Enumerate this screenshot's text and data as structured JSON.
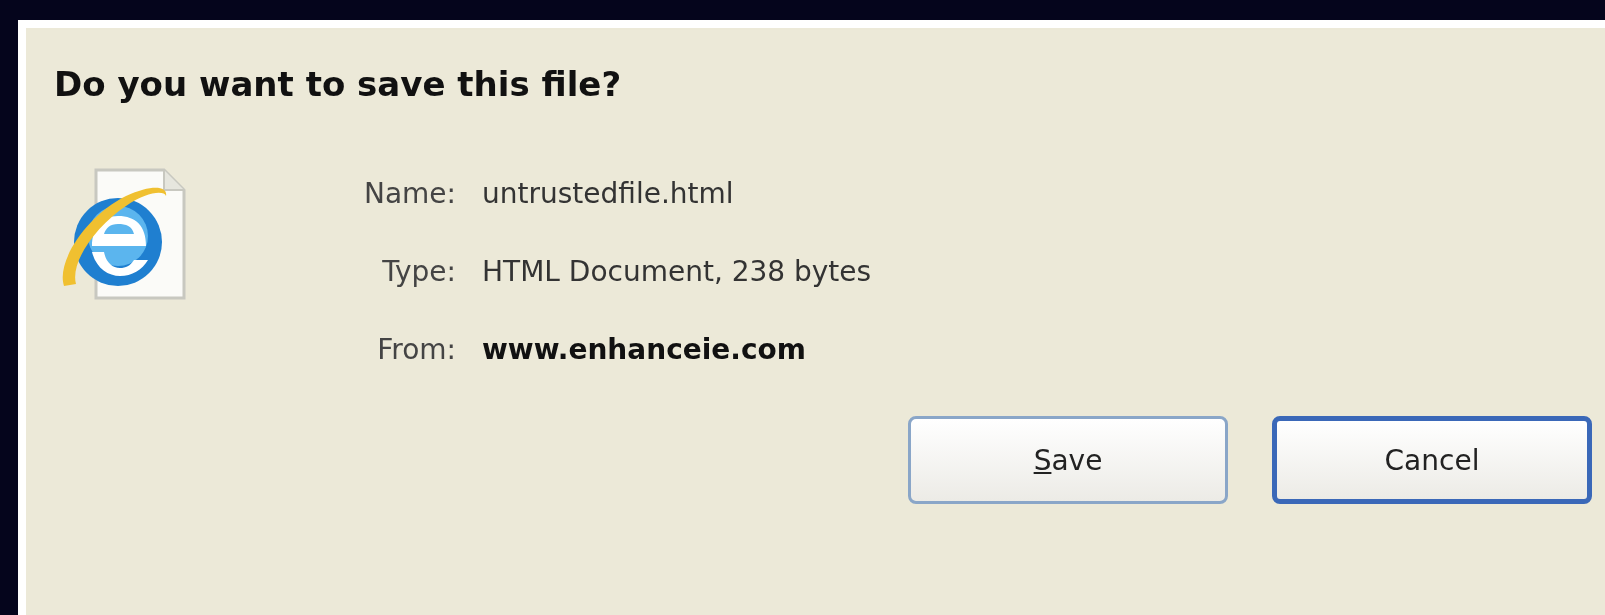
{
  "dialog": {
    "title": "Do you want to save this file?",
    "fields": [
      {
        "label": "Name:",
        "value": "untrustedfile.html",
        "bold": false
      },
      {
        "label": "Type:",
        "value": "HTML Document, 238 bytes",
        "bold": false
      },
      {
        "label": "From:",
        "value": "www.enhanceie.com",
        "bold": true
      }
    ],
    "buttons": [
      {
        "label": "Save",
        "default": false
      },
      {
        "label": "Cancel",
        "default": true
      }
    ]
  }
}
